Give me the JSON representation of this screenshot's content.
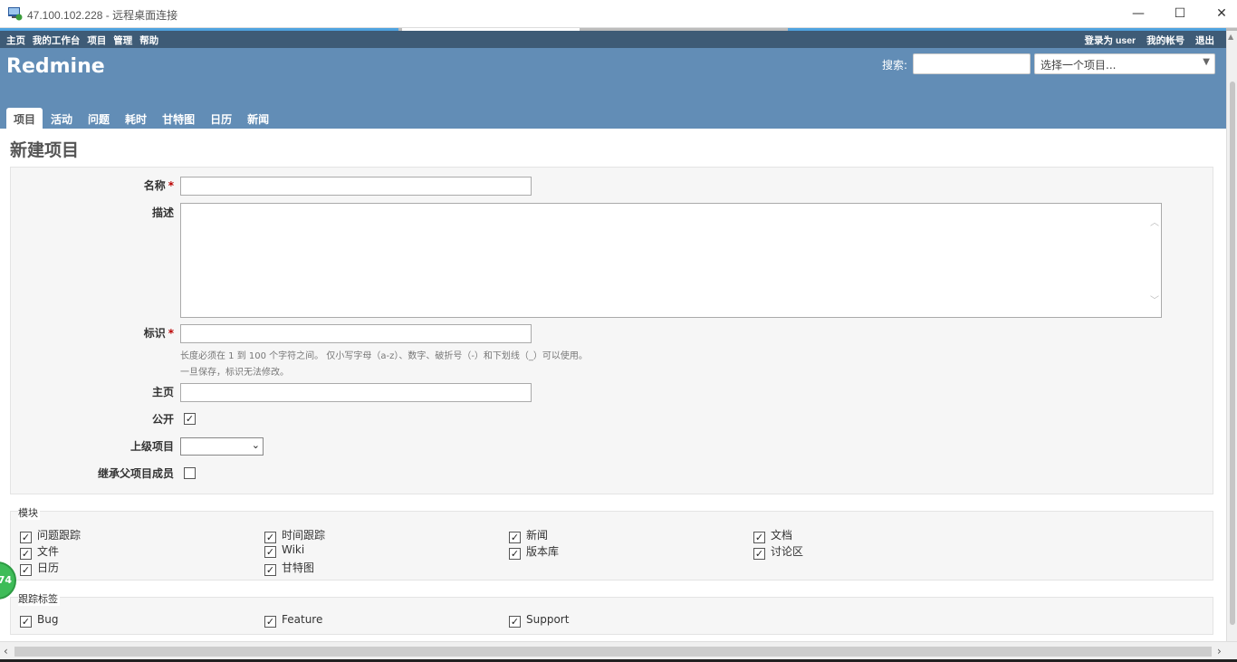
{
  "window": {
    "title": "47.100.102.228 - 远程桌面连接",
    "minimize": "—",
    "maximize": "☐",
    "close": "✕"
  },
  "top_menu": {
    "left": [
      "主页",
      "我的工作台",
      "项目",
      "管理",
      "帮助"
    ],
    "logged_in_as": "登录为 user",
    "my_account": "我的帐号",
    "logout": "退出"
  },
  "header": {
    "site_title": "Redmine",
    "search_label": "搜索:",
    "search_value": "",
    "project_jump": "选择一个项目..."
  },
  "main_menu": [
    {
      "label": "项目",
      "selected": true
    },
    {
      "label": "活动",
      "selected": false
    },
    {
      "label": "问题",
      "selected": false
    },
    {
      "label": "耗时",
      "selected": false
    },
    {
      "label": "甘特图",
      "selected": false
    },
    {
      "label": "日历",
      "selected": false
    },
    {
      "label": "新闻",
      "selected": false
    }
  ],
  "form": {
    "page_title": "新建项目",
    "name_label": "名称",
    "required_mark": "*",
    "description_label": "描述",
    "identifier_label": "标识",
    "identifier_hint1": "长度必须在 1 到 100 个字符之间。 仅小写字母（a-z）、数字、破折号（-）和下划线（_）可以使用。",
    "identifier_hint2": "一旦保存，标识无法修改。",
    "homepage_label": "主页",
    "public_label": "公开",
    "public_checked": true,
    "parent_label": "上级项目",
    "parent_value": "",
    "inherit_label": "继承父项目成员",
    "inherit_checked": false
  },
  "modules": {
    "legend": "模块",
    "items": [
      {
        "label": "问题跟踪",
        "checked": true
      },
      {
        "label": "时间跟踪",
        "checked": true
      },
      {
        "label": "新闻",
        "checked": true
      },
      {
        "label": "文档",
        "checked": true
      },
      {
        "label": "文件",
        "checked": true
      },
      {
        "label": "Wiki",
        "checked": true
      },
      {
        "label": "版本库",
        "checked": true
      },
      {
        "label": "讨论区",
        "checked": true
      },
      {
        "label": "日历",
        "checked": true
      },
      {
        "label": "甘特图",
        "checked": true
      }
    ]
  },
  "trackers": {
    "legend": "跟踪标签",
    "items": [
      {
        "label": "Bug",
        "checked": true
      },
      {
        "label": "Feature",
        "checked": true
      },
      {
        "label": "Support",
        "checked": true
      }
    ]
  },
  "floating_badge": "74",
  "colors": {
    "top_menu_bg": "#3e5b76",
    "header_bg": "#628db6",
    "box_bg": "#f6f6f6",
    "required": "#bb0000"
  }
}
